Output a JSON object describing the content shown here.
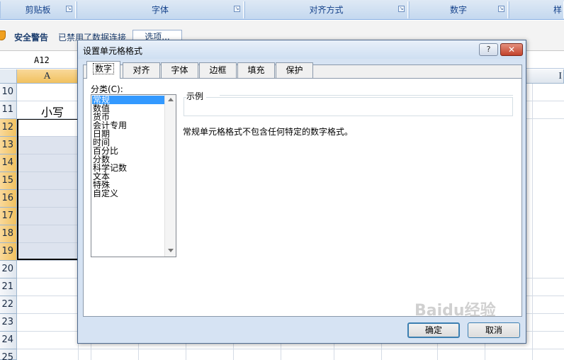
{
  "ribbon": {
    "groups": [
      {
        "label": "剪贴板"
      },
      {
        "label": "字体"
      },
      {
        "label": "对齐方式"
      },
      {
        "label": "数字"
      },
      {
        "label": "样"
      }
    ],
    "launcher_icon": "dialog-launcher-icon"
  },
  "security_bar": {
    "icon": "shield-icon",
    "title": "安全警告",
    "message": "已禁用了数据连接",
    "options_button": "选项..."
  },
  "formula_bar": {
    "name_box": "A12"
  },
  "grid": {
    "columns": [
      "A",
      "I"
    ],
    "rows": [
      "10",
      "11",
      "12",
      "13",
      "14",
      "15",
      "16",
      "17",
      "18",
      "19",
      "20",
      "21",
      "22",
      "23",
      "24",
      "25"
    ],
    "selected_rows": [
      "12",
      "13",
      "14",
      "15",
      "16",
      "17",
      "18",
      "19"
    ],
    "cells": {
      "A11": "小写"
    }
  },
  "dialog": {
    "title": "设置单元格格式",
    "help_button": "?",
    "close_button": "✕",
    "tabs": [
      {
        "label": "数字",
        "active": true
      },
      {
        "label": "对齐",
        "active": false
      },
      {
        "label": "字体",
        "active": false
      },
      {
        "label": "边框",
        "active": false
      },
      {
        "label": "填充",
        "active": false
      },
      {
        "label": "保护",
        "active": false
      }
    ],
    "category_label": "分类(C):",
    "categories": [
      "常规",
      "数值",
      "货币",
      "会计专用",
      "日期",
      "时间",
      "百分比",
      "分数",
      "科学记数",
      "文本",
      "特殊",
      "自定义"
    ],
    "selected_category": "常规",
    "sample_label": "示例",
    "sample_value": "",
    "description": "常规单元格格式不包含任何特定的数字格式。",
    "ok_button": "确定",
    "cancel_button": "取消"
  },
  "watermark": "Baidu经验"
}
